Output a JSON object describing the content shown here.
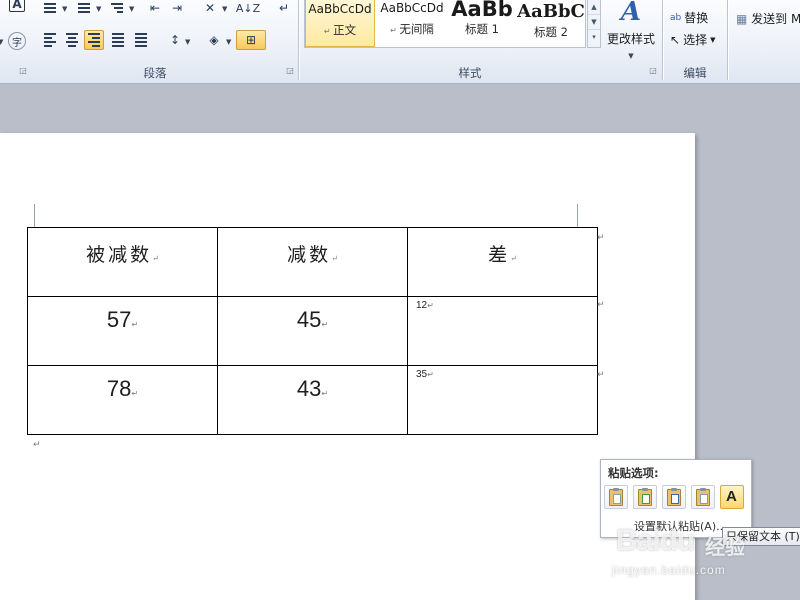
{
  "ribbon": {
    "groups": {
      "paragraph": "段落",
      "styles": "样式",
      "editing": "编辑"
    },
    "styles_gallery": [
      {
        "sample": "AaBbCcDd",
        "name": "正文",
        "selected": true
      },
      {
        "sample": "AaBbCcDd",
        "name": "无间隔",
        "selected": false
      },
      {
        "sample": "AaBb",
        "name": "标题 1",
        "selected": false
      },
      {
        "sample": "AaBbC",
        "name": "标题 2",
        "selected": false
      }
    ],
    "change_styles_label": "更改样式",
    "editing": {
      "replace": "替换",
      "select": "选择"
    },
    "send_to": "发送到 M",
    "sort_label": "A↓Z",
    "pinyin_glyph": "字"
  },
  "table": {
    "header": [
      "被减数",
      "减数",
      "差"
    ],
    "rows": [
      {
        "minuend": "57",
        "subtrahend": "45",
        "difference": "12"
      },
      {
        "minuend": "78",
        "subtrahend": "43",
        "difference": "35"
      }
    ]
  },
  "marks": {
    "paragraph": "↵"
  },
  "paste_popup": {
    "title": "粘贴选项:",
    "footer": "设置默认粘贴(A)...",
    "tooltip": "只保留文本 (T)",
    "options": [
      "keep-source-formatting",
      "merge-formatting",
      "use-destination-styles",
      "keep-text-only"
    ]
  },
  "watermark": {
    "brand": "Baidu",
    "suffix": "经验",
    "url": "jingyan.baidu.com"
  }
}
